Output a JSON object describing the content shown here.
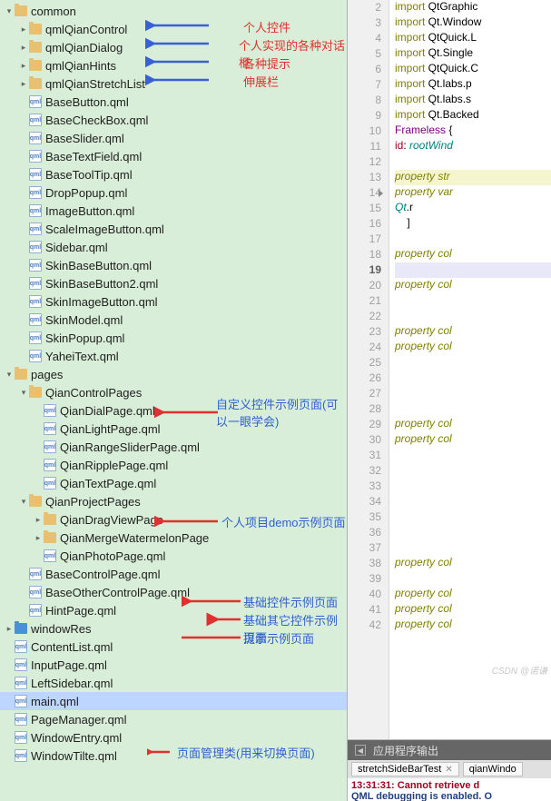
{
  "tree": {
    "common": "common",
    "qmlQianControl": "qmlQianControl",
    "qmlQianDialog": "qmlQianDialog",
    "qmlQianHints": "qmlQianHints",
    "qmlQianStretchList": "qmlQianStretchList",
    "baseButton": "BaseButton.qml",
    "baseCheckBox": "BaseCheckBox.qml",
    "baseSlider": "BaseSlider.qml",
    "baseTextField": "BaseTextField.qml",
    "baseToolTip": "BaseToolTip.qml",
    "dropPopup": "DropPopup.qml",
    "imageButton": "ImageButton.qml",
    "scaleImageButton": "ScaleImageButton.qml",
    "sidebar": "Sidebar.qml",
    "skinBaseButton": "SkinBaseButton.qml",
    "skinBaseButton2": "SkinBaseButton2.qml",
    "skinImageButton": "SkinImageButton.qml",
    "skinModel": "SkinModel.qml",
    "skinPopup": "SkinPopup.qml",
    "yaheiText": "YaheiText.qml",
    "pages": "pages",
    "qianControlPages": "QianControlPages",
    "qianDialPage": "QianDialPage.qml",
    "qianLightPage": "QianLightPage.qml",
    "qianRangeSliderPage": "QianRangeSliderPage.qml",
    "qianRipplePage": "QianRipplePage.qml",
    "qianTextPage": "QianTextPage.qml",
    "qianProjectPages": "QianProjectPages",
    "qianDragViewPage": "QianDragViewPage",
    "qianMergeWatermelonPage": "QianMergeWatermelonPage",
    "qianPhotoPage": "QianPhotoPage.qml",
    "baseControlPage": "BaseControlPage.qml",
    "baseOtherControlPage": "BaseOtherControlPage.qml",
    "hintPage": "HintPage.qml",
    "windowRes": "windowRes",
    "contentList": "ContentList.qml",
    "inputPage": "InputPage.qml",
    "leftSidebar": "LeftSidebar.qml",
    "mainQml": "main.qml",
    "pageManager": "PageManager.qml",
    "windowEntry": "WindowEntry.qml",
    "windowTilte": "WindowTilte.qml"
  },
  "annotations": {
    "personalControl": "个人控件",
    "personalDialog": "个人实现的各种对话框",
    "hints": "各种提示",
    "stretch": "伸展栏",
    "customExample": "自定义控件示例页面(可以一眼学会)",
    "projectDemo": "个人项目demo示例页面",
    "baseExample": "基础控件示例页面",
    "baseOtherExample": "基础其它控件示例页面",
    "hintExample": "提示示例页面",
    "pageMgr": "页面管理类(用来切换页面)"
  },
  "code": {
    "l2": "import QtGraphic",
    "l3": "import Qt.Window",
    "l4": "import QtQuick.L",
    "l5": "import Qt.Single",
    "l6": "import QtQuick.C",
    "l7": "import Qt.labs.p",
    "l8": "import Qt.labs.s",
    "l9": "import Qt.Backed",
    "l10a": "Frameless",
    "l10b": " {",
    "l11a": "id",
    "l11b": ": ",
    "l11c": "rootWind",
    "l13": "property str",
    "l14": "property var",
    "l15a": "Qt",
    "l15b": ".r",
    "l16": "]",
    "prop_col": "property col",
    "property": "property",
    "import": "import"
  },
  "gutter": [
    "2",
    "3",
    "4",
    "5",
    "6",
    "7",
    "8",
    "9",
    "10",
    "11",
    "12",
    "13",
    "14",
    "15",
    "16",
    "17",
    "18",
    "19",
    "20",
    "21",
    "22",
    "23",
    "24",
    "25",
    "26",
    "27",
    "28",
    "29",
    "30",
    "31",
    "32",
    "33",
    "34",
    "35",
    "36",
    "37",
    "38",
    "39",
    "40",
    "41",
    "42"
  ],
  "bottom": {
    "title": "应用程序输出",
    "tab1": "stretchSideBarTest",
    "tab2": "qianWindo",
    "out1": "13:31:31: Cannot retrieve d",
    "out2": "QML debugging is enabled. O"
  },
  "fileGlyph": "qml"
}
